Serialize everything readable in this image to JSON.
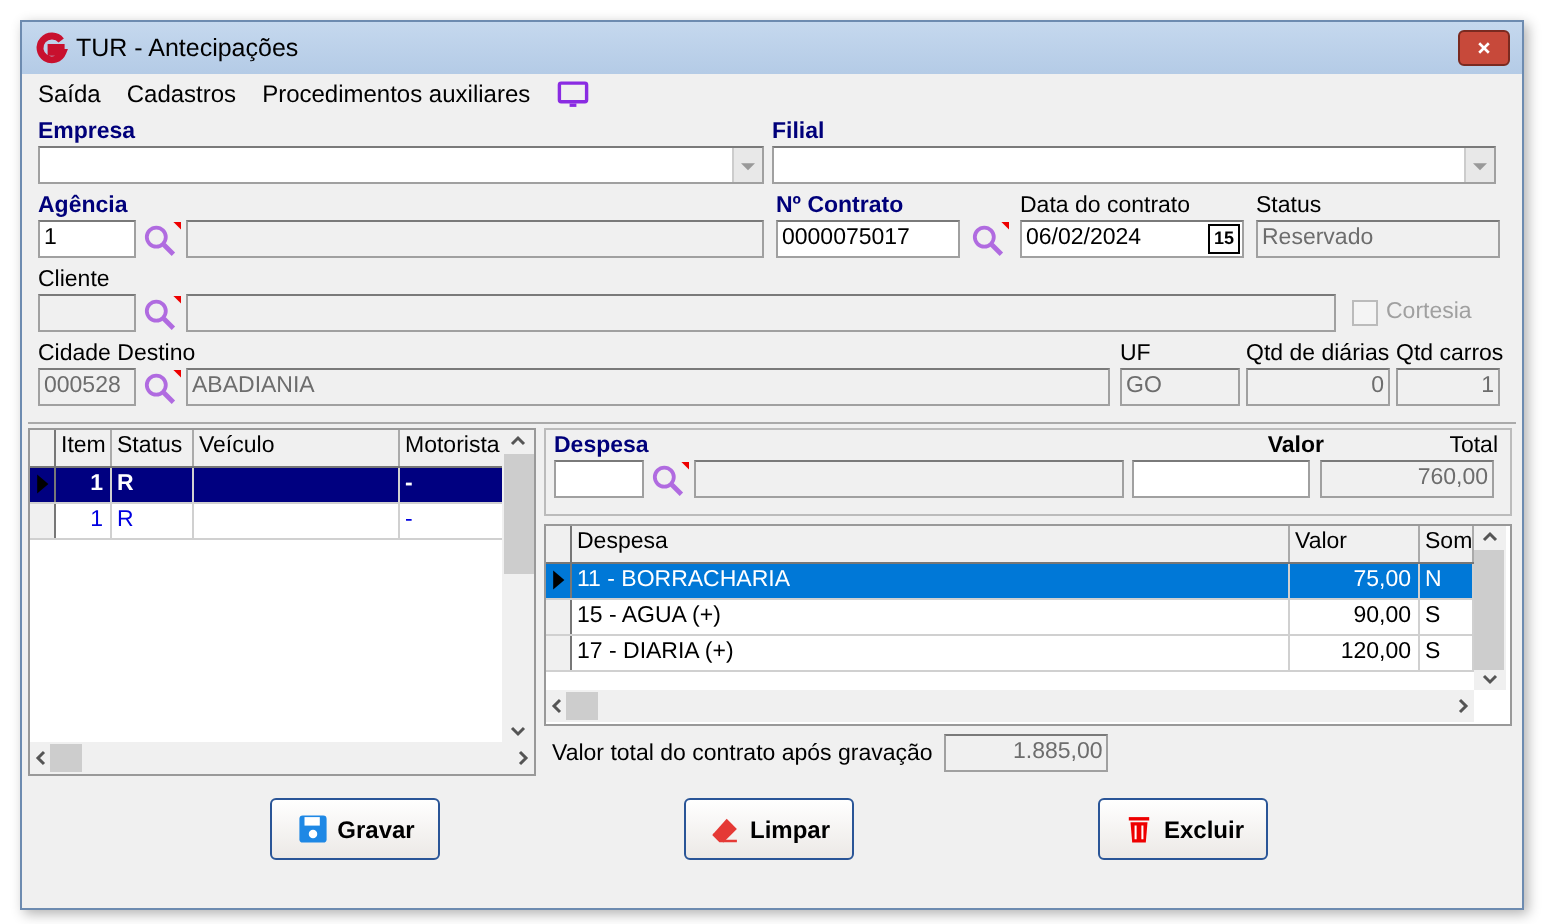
{
  "window": {
    "title": "TUR - Antecipações"
  },
  "menu": [
    {
      "label": "Saída"
    },
    {
      "label": "Cadastros"
    },
    {
      "label": "Procedimentos auxiliares"
    }
  ],
  "empresa": {
    "label": "Empresa"
  },
  "filial": {
    "label": "Filial"
  },
  "agencia": {
    "label": "Agência",
    "code": "1"
  },
  "contrato": {
    "label": "Nº Contrato",
    "value": "0000075017"
  },
  "data_contrato": {
    "label": "Data do contrato",
    "value": "06/02/2024",
    "calendar_button": "15"
  },
  "status": {
    "label": "Status",
    "value": "Reservado"
  },
  "cliente": {
    "label": "Cliente"
  },
  "cortesia": {
    "label": "Cortesia",
    "checked": false,
    "disabled": true
  },
  "cidade_destino": {
    "label": "Cidade Destino",
    "code": "000528",
    "name": "ABADIANIA"
  },
  "uf": {
    "label": "UF",
    "value": "GO"
  },
  "qtd_diarias": {
    "label": "Qtd de diárias",
    "value": "0"
  },
  "qtd_carros": {
    "label": "Qtd carros",
    "value": "1"
  },
  "items_table": {
    "columns": [
      "Item",
      "Status",
      "Veículo",
      "Motorista"
    ],
    "rows": [
      {
        "item": "1",
        "status": "R",
        "motorista": "-",
        "selected": true
      },
      {
        "item": "1",
        "status": "R",
        "motorista": "-",
        "selected": false
      }
    ]
  },
  "despesa_form": {
    "label": "Despesa",
    "valor_label": "Valor",
    "total_label": "Total",
    "total_value": "760,00"
  },
  "despesa_table": {
    "columns": [
      "Despesa",
      "Valor",
      "Som"
    ],
    "rows": [
      {
        "despesa": "11 - BORRACHARIA",
        "valor": "75,00",
        "som": "N",
        "selected": true
      },
      {
        "despesa": "15 - AGUA (+)",
        "valor": "90,00",
        "som": "S",
        "selected": false
      },
      {
        "despesa": "17 - DIARIA (+)",
        "valor": "120,00",
        "som": "S",
        "selected": false
      }
    ]
  },
  "contract_total": {
    "label": "Valor total do contrato após gravação",
    "value": "1.885,00"
  },
  "buttons": [
    {
      "label": "Gravar",
      "kind": "save"
    },
    {
      "label": "Limpar",
      "kind": "clear"
    },
    {
      "label": "Excluir",
      "kind": "delete"
    }
  ]
}
